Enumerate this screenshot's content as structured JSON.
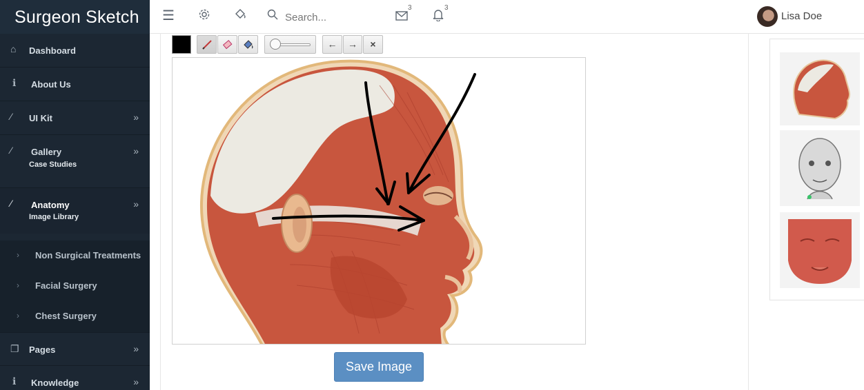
{
  "app": {
    "title": "Surgeon Sketch"
  },
  "sidebar": {
    "items": [
      {
        "label": "Dashboard",
        "icon": "home-icon"
      },
      {
        "label": "About Us",
        "icon": "info-icon"
      },
      {
        "label": "UI Kit",
        "icon": "wand-icon"
      },
      {
        "label": "Gallery",
        "sublabel": "Case Studies",
        "icon": "wand-icon"
      },
      {
        "label": "Anatomy",
        "sublabel": "Image Library",
        "icon": "wand-icon"
      },
      {
        "label": "Pages",
        "icon": "pages-icon"
      },
      {
        "label": "Knowledge",
        "icon": "info-icon"
      }
    ],
    "subitems": [
      {
        "label": "Non Surgical Treatments"
      },
      {
        "label": "Facial Surgery"
      },
      {
        "label": "Chest Surgery"
      }
    ]
  },
  "topbar": {
    "search_placeholder": "Search...",
    "mail_count": "3",
    "notif_count": "3",
    "user_name": "Lisa Doe"
  },
  "toolbar": {
    "undo_label": "←",
    "redo_label": "→",
    "clear_label": "×",
    "active_color": "#000000"
  },
  "editor": {
    "save_label": "Save Image"
  }
}
